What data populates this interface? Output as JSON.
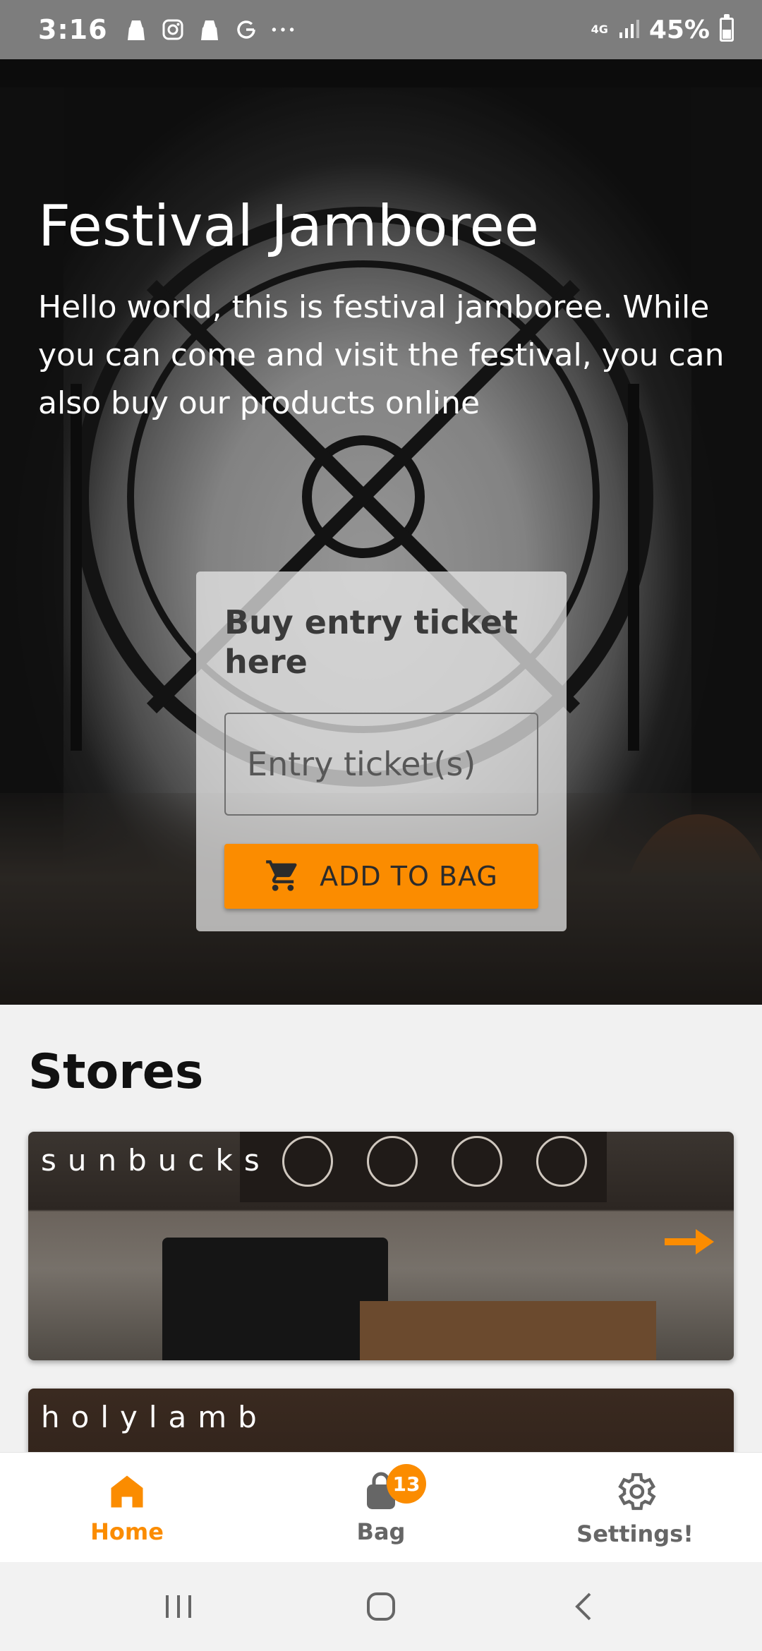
{
  "status_bar": {
    "time": "3:16",
    "network": "4G",
    "battery": "45%",
    "battery_level": 0.45
  },
  "hero": {
    "title": "Festival Jamboree",
    "description": "Hello world, this is festival jamboree. While you can come and visit the festival, you can also buy our products online",
    "ticket_card": {
      "title": "Buy entry ticket here",
      "input_placeholder": "Entry ticket(s)",
      "button_label": "ADD TO BAG"
    }
  },
  "stores": {
    "title": "Stores",
    "items": [
      {
        "name": "sunbucks"
      },
      {
        "name": "holylamb"
      }
    ]
  },
  "bottom_nav": {
    "items": [
      {
        "label": "Home",
        "icon": "home-icon"
      },
      {
        "label": "Bag",
        "icon": "bag-icon",
        "badge": "13"
      },
      {
        "label": "Settings!",
        "icon": "gear-icon"
      }
    ]
  },
  "colors": {
    "accent": "#fb8c00",
    "status_bar": "#7d7d7d",
    "nav_inactive": "#666666"
  }
}
